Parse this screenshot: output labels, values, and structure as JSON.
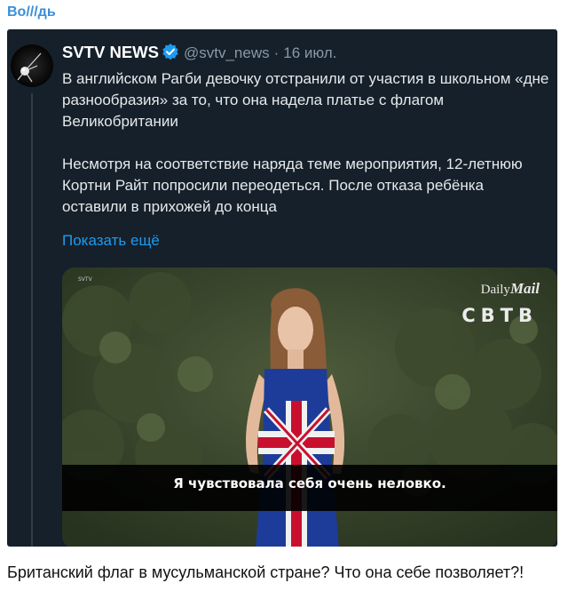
{
  "message": {
    "sender_name": "Во///дь",
    "caption": "Британский флаг в мусульманской стране? Что она себе позволяет?!"
  },
  "tweet": {
    "author": "SVTV NEWS",
    "handle": "@svtv_news",
    "separator": "·",
    "date": "16 июл.",
    "paragraphs": [
      "В английском Рагби девочку отстранили от участия в школьном «дне разнообразия» за то, что она надела платье с флагом Великобритании",
      "Несмотря на соответствие наряда теме мероприятия, 12-летнюю Кортни Райт попросили переодеться. После отказа ребёнка оставили в прихожей до конца"
    ],
    "show_more": "Показать ещё",
    "avatar_icon": "satellite-icon",
    "verified_icon": "verified-badge-icon",
    "accent_color": "#1d9bf0",
    "media": {
      "watermark_daily": "Daily",
      "watermark_mail": "Mail",
      "watermark_channel": "СВТВ",
      "watermark_small": "SVTV",
      "subtitle": "Я чувствовала себя очень неловко."
    }
  }
}
